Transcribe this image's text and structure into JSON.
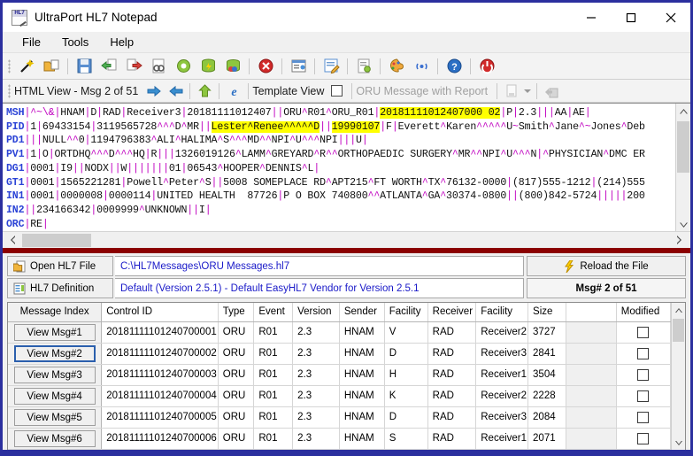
{
  "window": {
    "title": "UltraPort HL7 Notepad",
    "icon": "hl7-notepad-icon",
    "minimize": "minimize-icon",
    "maximize": "maximize-icon",
    "close": "close-icon"
  },
  "menu": {
    "items": [
      {
        "label": "File"
      },
      {
        "label": "Tools"
      },
      {
        "label": "Help"
      }
    ]
  },
  "toolbar": {
    "buttons": [
      {
        "name": "new-message-wand-icon"
      },
      {
        "name": "open-folder-icon"
      },
      {
        "name": "save-icon"
      },
      {
        "name": "import-left-icon"
      },
      {
        "name": "export-right-icon"
      },
      {
        "name": "find-binoculars-icon"
      },
      {
        "name": "settings-gear-icon"
      },
      {
        "name": "database-icon"
      },
      {
        "name": "database-colors-icon"
      },
      {
        "name": "stop-error-icon"
      },
      {
        "name": "window-view-icon"
      },
      {
        "name": "edit-note-icon"
      },
      {
        "name": "document-properties-icon"
      },
      {
        "name": "palette-icon"
      },
      {
        "name": "broadcast-icon"
      },
      {
        "name": "help-icon"
      },
      {
        "name": "exit-power-icon"
      }
    ]
  },
  "viewbar": {
    "label": "HTML View - Msg 2 of 51",
    "next_icon": "arrow-right-icon",
    "prev_icon": "arrow-left-icon",
    "up_icon": "arrow-up-icon",
    "browser_icon": "internet-explorer-icon",
    "template_view_label": "Template View",
    "template_view_checked": false,
    "report_label": "ORU Message with Report",
    "export_report_icon": "export-report-icon",
    "export_dropdown_icon": "chevron-down-icon",
    "compare_icon": "compare-messages-icon"
  },
  "message": {
    "lines": [
      [
        {
          "t": "seg",
          "v": "MSH"
        },
        {
          "t": "bar",
          "v": "|"
        },
        {
          "t": "txt",
          "v": "^~\\&"
        },
        {
          "t": "bar",
          "v": "|"
        },
        {
          "t": "txt",
          "v": "HNAM"
        },
        {
          "t": "bar",
          "v": "|"
        },
        {
          "t": "txt",
          "v": "D"
        },
        {
          "t": "bar",
          "v": "|"
        },
        {
          "t": "txt",
          "v": "RAD"
        },
        {
          "t": "bar",
          "v": "|"
        },
        {
          "t": "txt",
          "v": "Receiver3"
        },
        {
          "t": "bar",
          "v": "|"
        },
        {
          "t": "txt",
          "v": "20181111012407"
        },
        {
          "t": "bar",
          "v": "||"
        },
        {
          "t": "txt",
          "v": "ORU^R01^ORU_R01"
        },
        {
          "t": "bar",
          "v": "|"
        },
        {
          "t": "hl",
          "v": "20181111012407000 02"
        },
        {
          "t": "bar",
          "v": "|"
        },
        {
          "t": "txt",
          "v": "P"
        },
        {
          "t": "bar",
          "v": "|"
        },
        {
          "t": "txt",
          "v": "2.3"
        },
        {
          "t": "bar",
          "v": "|||"
        },
        {
          "t": "txt",
          "v": "AA"
        },
        {
          "t": "bar",
          "v": "|"
        },
        {
          "t": "txt",
          "v": "AE"
        },
        {
          "t": "bar",
          "v": "|"
        }
      ]
    ],
    "raw_lines": [
      "MSH|^~\\&|HNAM|D|RAD|Receiver3|20181111012407||ORU^R01^ORU_R01|20181111012407000 02|P|2.3|||AA|AE|",
      "PID|1|69433154|3119565728^^^D^MR||Lester^Renee^^^^^D||19990107|F|Everett^Karen^^^^^U~Smith^Jane^~Jones^Deb",
      "PD1|||NULL^^0|1194796383^ALI^HALIMA^S^^^MD^^NPI^U^^^NPI|||U|",
      "PV1|1|O|ORTDHQ^^^D^^^HQ|R|||1326019126^LAMM^GREYARD^R^^ORTHOPAEDIC SURGERY^MR^^NPI^U^^^N|^PHYSICIAN^DMC ER",
      "DG1|0001|I9||NODX||W|||||||01|06543^HOOPER^DENNIS^L|",
      "GT1|0001|1565221281|Powell^Peter^S||5008 SOMEPLACE RD^APT215^FT WORTH^TX^76132-0000|(817)555-1212|(214)555",
      "IN1|0001|0000008|0000114|UNITED HEALTH  87726|P O BOX 740800^^ATLANTA^GA^30374-0800||(800)842-5724|||||200",
      "IN2||234166342|0009999^UNKNOWN||I|",
      "ORC|RE|"
    ],
    "highlights": [
      "20181111012407000 02",
      "Lester^Renee^^^^^D",
      "19990107"
    ],
    "scroll_up_icon": "scroll-up-icon",
    "scroll_down_icon": "scroll-down-icon",
    "hscroll_left_icon": "scroll-left-icon",
    "hscroll_right_icon": "scroll-right-icon"
  },
  "file_row": {
    "open_label": "Open HL7 File",
    "open_icon": "open-file-icon",
    "path": "C:\\HL7Messages\\ORU Messages.hl7",
    "reload_label": "Reload the File",
    "reload_icon": "lightning-reload-icon"
  },
  "definition_row": {
    "label": "HL7 Definition",
    "icon": "definition-icon",
    "value": "Default (Version 2.5.1) - Default EasyHL7 Vendor for Version 2.5.1",
    "counter": "Msg# 2 of 51"
  },
  "table": {
    "columns": [
      "Message Index",
      "Control ID",
      "Type",
      "Event",
      "Version",
      "Sender",
      "Facility",
      "Receiver",
      "Facility",
      "Size",
      "",
      "Modified"
    ],
    "rows": [
      {
        "button": "View Msg#1",
        "selected": false,
        "control_id": "20181111101240700001",
        "type": "ORU",
        "event": "R01",
        "version": "2.3",
        "sender": "HNAM",
        "facility1": "V",
        "receiver": "RAD",
        "facility2": "Receiver2",
        "size": "3727",
        "blank": "",
        "modified": false
      },
      {
        "button": "View Msg#2",
        "selected": true,
        "control_id": "20181111101240700002",
        "type": "ORU",
        "event": "R01",
        "version": "2.3",
        "sender": "HNAM",
        "facility1": "D",
        "receiver": "RAD",
        "facility2": "Receiver3",
        "size": "2841",
        "blank": "",
        "modified": false
      },
      {
        "button": "View Msg#3",
        "selected": false,
        "control_id": "20181111101240700003",
        "type": "ORU",
        "event": "R01",
        "version": "2.3",
        "sender": "HNAM",
        "facility1": "H",
        "receiver": "RAD",
        "facility2": "Receiver1",
        "size": "3504",
        "blank": "",
        "modified": false
      },
      {
        "button": "View Msg#4",
        "selected": false,
        "control_id": "20181111101240700004",
        "type": "ORU",
        "event": "R01",
        "version": "2.3",
        "sender": "HNAM",
        "facility1": "K",
        "receiver": "RAD",
        "facility2": "Receiver2",
        "size": "2228",
        "blank": "",
        "modified": false
      },
      {
        "button": "View Msg#5",
        "selected": false,
        "control_id": "20181111101240700005",
        "type": "ORU",
        "event": "R01",
        "version": "2.3",
        "sender": "HNAM",
        "facility1": "D",
        "receiver": "RAD",
        "facility2": "Receiver3",
        "size": "2084",
        "blank": "",
        "modified": false
      },
      {
        "button": "View Msg#6",
        "selected": false,
        "control_id": "20181111101240700006",
        "type": "ORU",
        "event": "R01",
        "version": "2.3",
        "sender": "HNAM",
        "facility1": "S",
        "receiver": "RAD",
        "facility2": "Receiver1",
        "size": "2071",
        "blank": "",
        "modified": false
      }
    ],
    "scroll_up_icon": "scroll-up-icon",
    "scroll_down_icon": "scroll-down-icon"
  },
  "colors": {
    "window_border": "#2b2f9e",
    "accent_red": "#8b0000",
    "segment_blue": "#2b43d6",
    "delimiter_magenta": "#c000c0",
    "highlight_yellow": "#ffff00",
    "link_blue": "#1919c8"
  }
}
